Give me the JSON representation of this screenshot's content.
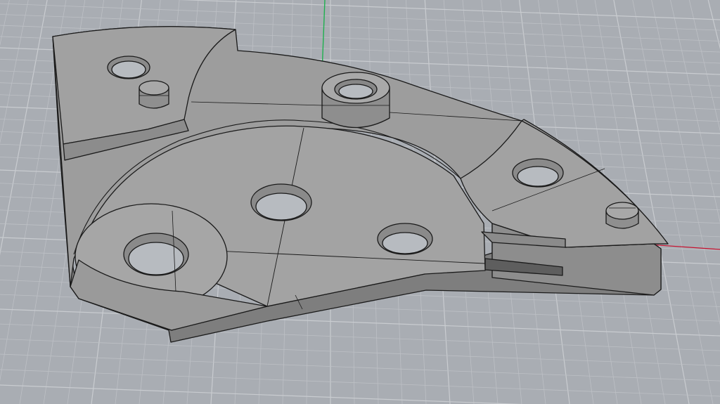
{
  "viewport": {
    "view_name": "",
    "background": "#a9adb3",
    "grid_minor": "#bdc0c5",
    "grid_major": "#c9ccd0",
    "axis_x_color": "#c8102e",
    "axis_y_color": "#1fb04f"
  },
  "model": {
    "face_color": "#9b9b9b",
    "face_light": "#a7a7a7",
    "face_dark": "#7a7a7a",
    "edge_color": "#1a1a1a",
    "hole_inner": "#b7bbc0"
  }
}
